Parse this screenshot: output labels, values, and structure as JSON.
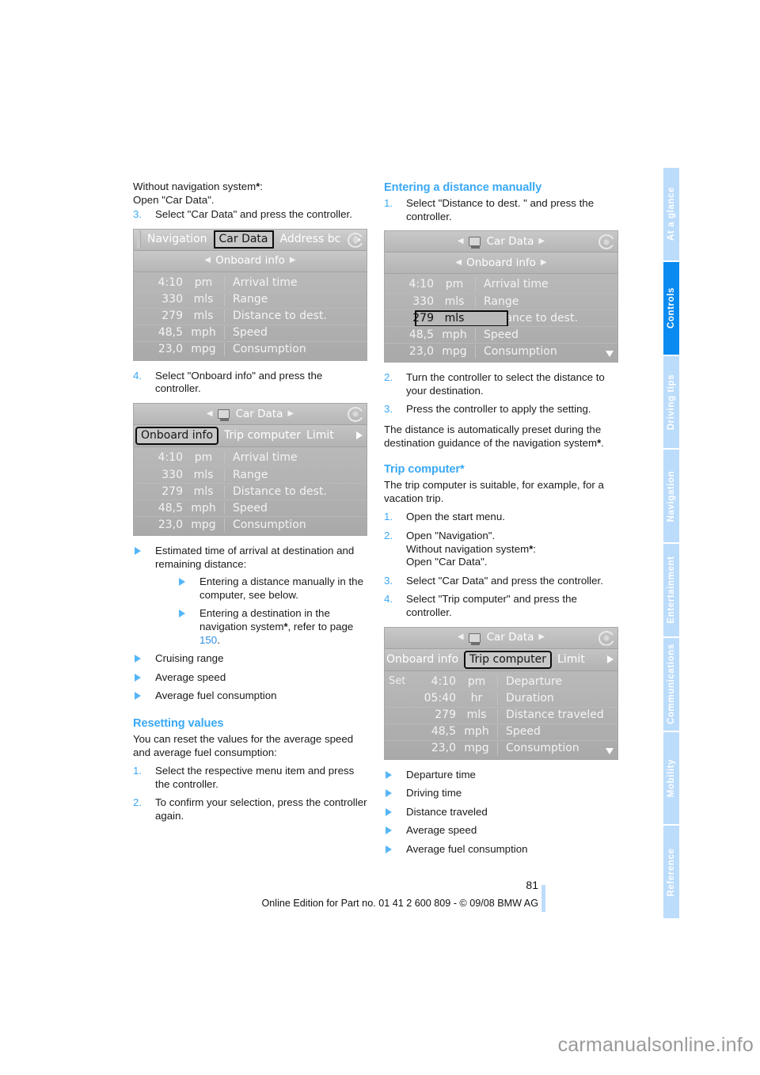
{
  "page": {
    "number": "81",
    "footer_line": "Online Edition for Part no. 01 41 2 600 809 - © 09/08 BMW AG",
    "watermark": "carmanualsonline.info"
  },
  "sidebar": {
    "active_index": 1,
    "tabs": [
      {
        "label": "At a glance"
      },
      {
        "label": "Controls"
      },
      {
        "label": "Driving tips"
      },
      {
        "label": "Navigation"
      },
      {
        "label": "Entertainment"
      },
      {
        "label": "Communications"
      },
      {
        "label": "Mobility"
      },
      {
        "label": "Reference"
      }
    ]
  },
  "left_column": {
    "intro_line1": "Without navigation system",
    "intro_line2": "Open \"Car Data\".",
    "step3_num": "3.",
    "step3_text": "Select \"Car Data\" and press the controller.",
    "step4_num": "4.",
    "step4_text": "Select \"Onboard info\" and press the controller.",
    "bullets": {
      "b1": "Estimated time of arrival at destination and remaining distance:",
      "b1_sub1": "Entering a distance manually in the computer, see below.",
      "b1_sub2_pre": "Entering a destination in the navigation system",
      "b1_sub2_mid": ", refer to page ",
      "b1_sub2_ref": "150",
      "b1_sub2_end": ".",
      "b2": "Cruising range",
      "b3": "Average speed",
      "b4": "Average fuel consumption"
    },
    "resetting": {
      "heading": "Resetting values",
      "intro": "You can reset the values for the average speed and average fuel consumption:",
      "step1_num": "1.",
      "step1_text": "Select the respective menu item and press the controller.",
      "step2_num": "2.",
      "step2_text": "To confirm your selection, press the controller again."
    }
  },
  "right_column": {
    "entering": {
      "heading": "Entering a distance manually",
      "step1_num": "1.",
      "step1_text": "Select \"Distance to dest. \" and press the controller.",
      "step2_num": "2.",
      "step2_text": "Turn the controller to select the distance to your destination.",
      "step3_num": "3.",
      "step3_text": "Press the controller to apply the setting.",
      "note_pre": "The distance is automatically preset during the destination guidance of the navigation system",
      "note_end": "."
    },
    "trip": {
      "heading_text": "Trip computer",
      "heading_star": "*",
      "intro": "The trip computer is suitable, for example, for a vacation trip.",
      "step1_num": "1.",
      "step1_text": "Open the start menu.",
      "step2_num": "2.",
      "step2_line1": "Open \"Navigation\".",
      "step2_line2": "Without navigation system",
      "step2_line3": "Open \"Car Data\".",
      "step3_num": "3.",
      "step3_text": "Select \"Car Data\" and press the controller.",
      "step4_num": "4.",
      "step4_text": "Select \"Trip computer\" and press the controller.",
      "bullets": {
        "b1": "Departure time",
        "b2": "Driving time",
        "b3": "Distance traveled",
        "b4": "Average speed",
        "b5": "Average fuel consumption"
      }
    }
  },
  "screens": {
    "screen1": {
      "menu": {
        "item1": "Navigation",
        "item2": "Car Data",
        "item3": "Address bc"
      },
      "title": "Onboard info",
      "rows": [
        {
          "value": "4:10",
          "unit": "pm",
          "label": "Arrival time"
        },
        {
          "value": "330",
          "unit": "mls",
          "label": "Range"
        },
        {
          "value": "279",
          "unit": "mls",
          "label": "Distance to dest."
        },
        {
          "value": "48,5",
          "unit": "mph",
          "label": "Speed"
        },
        {
          "value": "23,0",
          "unit": "mpg",
          "label": "Consumption"
        }
      ]
    },
    "screen2": {
      "title": "Car Data",
      "tabs": {
        "tab1": "Onboard info",
        "tab2": "Trip computer",
        "tab3": "Limit"
      },
      "rows": [
        {
          "value": "4:10",
          "unit": "pm",
          "label": "Arrival time"
        },
        {
          "value": "330",
          "unit": "mls",
          "label": "Range"
        },
        {
          "value": "279",
          "unit": "mls",
          "label": "Distance to dest."
        },
        {
          "value": "48,5",
          "unit": "mph",
          "label": "Speed"
        },
        {
          "value": "23,0",
          "unit": "mpg",
          "label": "Consumption"
        }
      ]
    },
    "screen3": {
      "title": "Car Data",
      "subtitle": "Onboard info",
      "rows": [
        {
          "value": "4:10",
          "unit": "pm",
          "label": "Arrival time"
        },
        {
          "value": "330",
          "unit": "mls",
          "label": "Range"
        },
        {
          "value": "279",
          "unit": "mls",
          "label": "Distance to dest."
        },
        {
          "value": "48,5",
          "unit": "mph",
          "label": "Speed"
        },
        {
          "value": "23,0",
          "unit": "mpg",
          "label": "Consumption"
        }
      ]
    },
    "screen4": {
      "title": "Car Data",
      "tabs": {
        "tab1": "Onboard info",
        "tab2": "Trip computer",
        "tab3": "Limit"
      },
      "set_label": "Set",
      "rows": [
        {
          "value": "4:10",
          "unit": "pm",
          "label": "Departure"
        },
        {
          "value": "05:40",
          "unit": "hr",
          "label": "Duration"
        },
        {
          "value": "279",
          "unit": "mls",
          "label": "Distance traveled"
        },
        {
          "value": "48,5",
          "unit": "mph",
          "label": "Speed"
        },
        {
          "value": "23,0",
          "unit": "mpg",
          "label": "Consumption"
        }
      ]
    }
  },
  "colors": {
    "accent_blue": "#3aa9f5",
    "tab_active": "#0a8bf2",
    "tab_inactive": "#bcdcfb"
  }
}
